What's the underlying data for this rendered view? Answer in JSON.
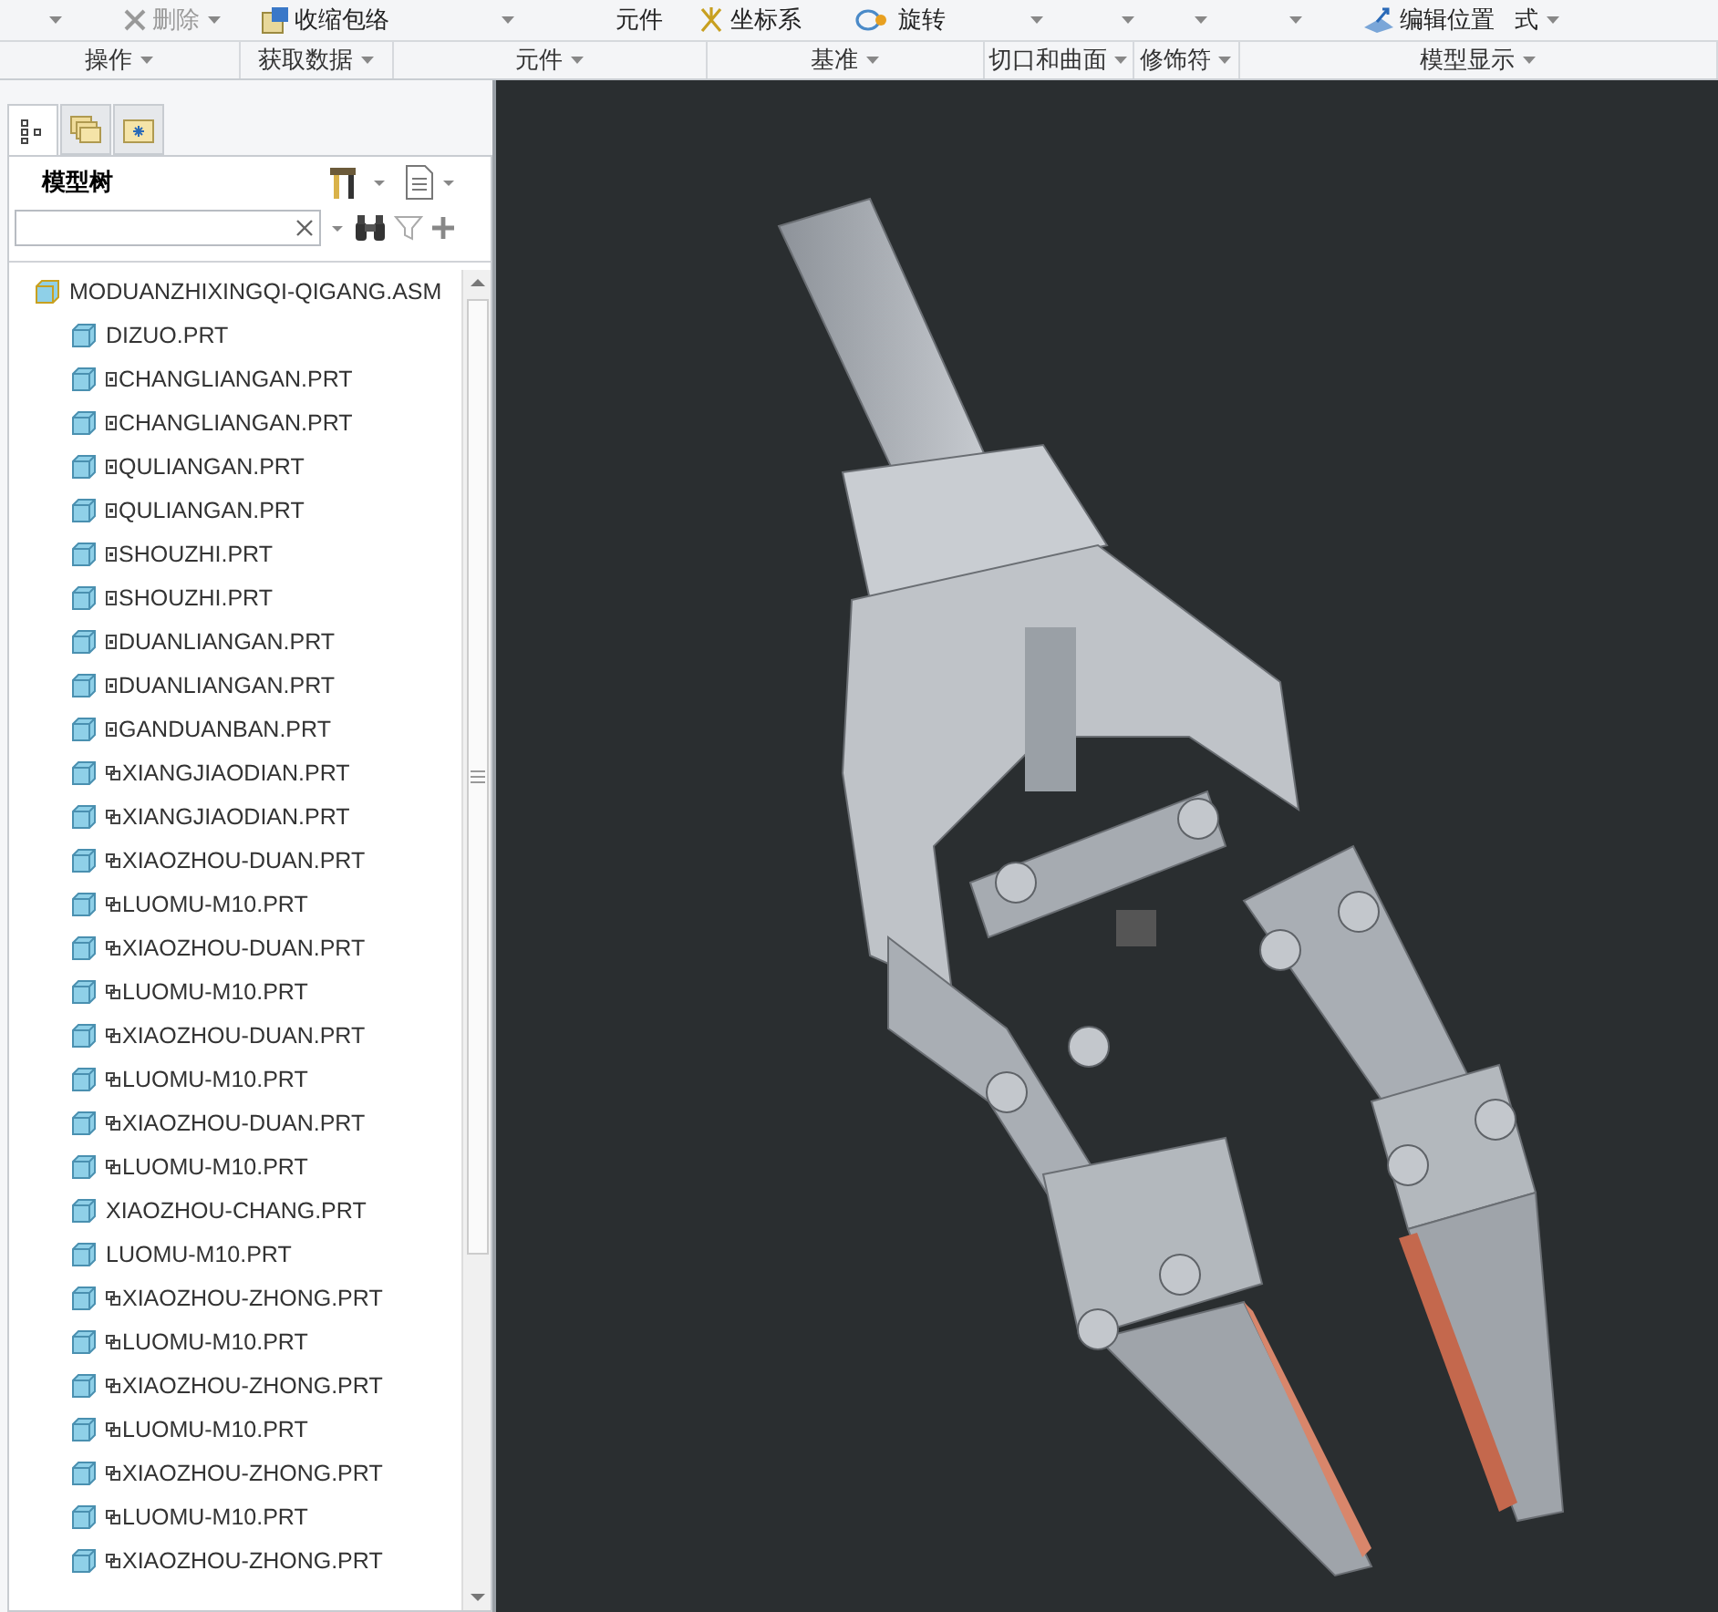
{
  "ribbon": {
    "commands": [
      {
        "caret": true
      },
      {
        "label": "删除",
        "caret": true,
        "disabled": true
      },
      {
        "label": "收缩包络",
        "caret": false,
        "disabled": false
      },
      {
        "caret": true
      },
      {
        "label": "元件",
        "caret": false
      },
      {
        "label": "坐标系",
        "caret": false,
        "disabled": false
      },
      {
        "label": "旋转",
        "caret": false,
        "disabled": false
      },
      {
        "caret": true
      },
      {
        "caret": true
      },
      {
        "caret": true
      },
      {
        "caret": true
      },
      {
        "label": "编辑位置",
        "caret": false,
        "disabled": false
      },
      {
        "label": "式",
        "caret": true
      }
    ],
    "groups": [
      {
        "label": "操作"
      },
      {
        "label": "获取数据"
      },
      {
        "label": "元件"
      },
      {
        "label": "基准"
      },
      {
        "label": "切口和曲面"
      },
      {
        "label": "修饰符"
      },
      {
        "label": "模型显示"
      }
    ]
  },
  "navigator": {
    "tabs": [
      {
        "kind": "tree",
        "selected": true
      },
      {
        "kind": "folder",
        "selected": false
      },
      {
        "kind": "favorites",
        "selected": false
      }
    ],
    "title": "模型树",
    "root": {
      "label": "MODUANZHIXINGQI-QIGANG.ASM",
      "children": [
        {
          "label": "DIZUO.PRT",
          "kind": "plain"
        },
        {
          "label": "CHANGLIANGAN.PRT",
          "kind": "boxed"
        },
        {
          "label": "CHANGLIANGAN.PRT",
          "kind": "boxed"
        },
        {
          "label": "QULIANGAN.PRT",
          "kind": "boxed"
        },
        {
          "label": "QULIANGAN.PRT",
          "kind": "boxed"
        },
        {
          "label": "SHOUZHI.PRT",
          "kind": "boxed"
        },
        {
          "label": "SHOUZHI.PRT",
          "kind": "boxed"
        },
        {
          "label": "DUANLIANGAN.PRT",
          "kind": "boxed"
        },
        {
          "label": "DUANLIANGAN.PRT",
          "kind": "boxed"
        },
        {
          "label": "GANDUANBAN.PRT",
          "kind": "boxed"
        },
        {
          "label": "XIANGJIAODIAN.PRT",
          "kind": "linked"
        },
        {
          "label": "XIANGJIAODIAN.PRT",
          "kind": "linked"
        },
        {
          "label": "XIAOZHOU-DUAN.PRT",
          "kind": "linked"
        },
        {
          "label": "LUOMU-M10.PRT",
          "kind": "linked"
        },
        {
          "label": "XIAOZHOU-DUAN.PRT",
          "kind": "linked"
        },
        {
          "label": "LUOMU-M10.PRT",
          "kind": "linked"
        },
        {
          "label": "XIAOZHOU-DUAN.PRT",
          "kind": "linked"
        },
        {
          "label": "LUOMU-M10.PRT",
          "kind": "linked"
        },
        {
          "label": "XIAOZHOU-DUAN.PRT",
          "kind": "linked"
        },
        {
          "label": "LUOMU-M10.PRT",
          "kind": "linked"
        },
        {
          "label": "XIAOZHOU-CHANG.PRT",
          "kind": "plain"
        },
        {
          "label": "LUOMU-M10.PRT",
          "kind": "plain"
        },
        {
          "label": "XIAOZHOU-ZHONG.PRT",
          "kind": "linked"
        },
        {
          "label": "LUOMU-M10.PRT",
          "kind": "linked"
        },
        {
          "label": "XIAOZHOU-ZHONG.PRT",
          "kind": "linked"
        },
        {
          "label": "LUOMU-M10.PRT",
          "kind": "linked"
        },
        {
          "label": "XIAOZHOU-ZHONG.PRT",
          "kind": "linked"
        },
        {
          "label": "LUOMU-M10.PRT",
          "kind": "linked"
        },
        {
          "label": "XIAOZHOU-ZHONG.PRT",
          "kind": "linked"
        }
      ]
    }
  }
}
